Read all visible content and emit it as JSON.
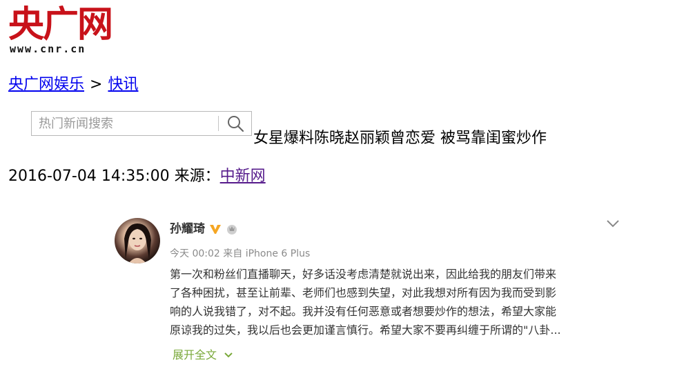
{
  "logo": {
    "text": "央广网",
    "url": "www.cnr.cn"
  },
  "breadcrumb": {
    "section": "央广网娱乐",
    "separator": ">",
    "subsection": "快讯"
  },
  "search": {
    "placeholder": "热门新闻搜索",
    "value": "",
    "icon": "search-icon"
  },
  "article": {
    "headline": "女星爆料陈晓赵丽颖曾恋爱 被骂靠闺蜜炒作",
    "timestamp": "2016-07-04 14:35:00",
    "source_label": "来源：",
    "source": "中新网"
  },
  "weibo_post": {
    "username": "孙耀琦",
    "time": "今天 00:02",
    "via": "来自",
    "device": "iPhone 6 Plus",
    "lines": [
      "第一次和粉丝们直播聊天，好多话没考虑清楚就说出来，因此给我的朋友们带来",
      "了各种困扰，甚至让前辈、老师们也感到失望，对此我想对所有因为我而受到影",
      "响的人说我错了，对不起。我并没有任何恶意或者想要炒作的想法，希望大家能",
      "原谅我的过失，我以后也会更加谨言慎行。希望大家不要再纠缠于所谓的\"八卦..."
    ],
    "expand_label": "展开全文",
    "icons": [
      "verified-v-icon",
      "member-badge-icon",
      "chevron-down-icon"
    ]
  },
  "colors": {
    "logo_red": "#c8121a",
    "link": "#0000ee",
    "visited_link": "#551a8b",
    "verified": "#f5a623",
    "expand": "#7aa93a"
  }
}
